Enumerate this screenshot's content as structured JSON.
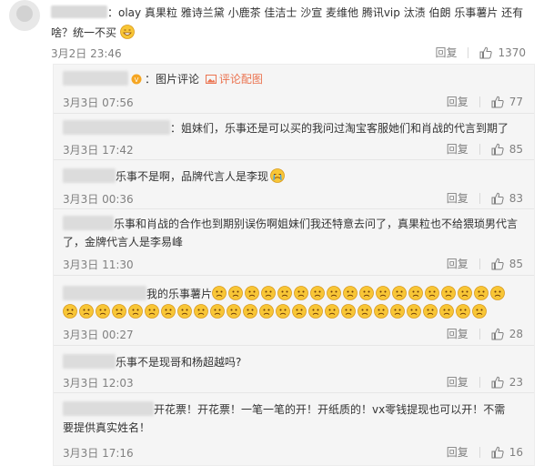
{
  "main_comment": {
    "text_line1": "：olay 真果粒 雅诗兰黛 小鹿茶 佳洁士 沙宣 麦维他 腾讯vip 汰渍 伯朗 乐事薯片 还有",
    "text_line2": "啥？统一不买",
    "date": "3月2日 23:46",
    "reply_label": "回复",
    "likes": "1370"
  },
  "replies": [
    {
      "text": "：图片评论",
      "link": "评论配图",
      "date": "3月3日 07:56",
      "reply_label": "回复",
      "likes": "77"
    },
    {
      "text": "：姐妹们，乐事还是可以买的我问过淘宝客服她们和肖战的代言到期了",
      "date": "3月3日 17:42",
      "reply_label": "回复",
      "likes": "85"
    },
    {
      "text": "乐事不是啊，品牌代言人是李现",
      "date": "3月3日 00:36",
      "reply_label": "回复",
      "likes": "83"
    },
    {
      "text_line1": "乐事和肖战的合作也到期别误伤啊姐妹们我还特意去问了，真果粒也不给猥琐男代言",
      "text_line2": "了，金牌代言人是李易峰",
      "date": "3月3日 11:30",
      "reply_label": "回复",
      "likes": "85"
    },
    {
      "text": "我的乐事薯片",
      "date": "3月3日 00:27",
      "reply_label": "回复",
      "likes": "28"
    },
    {
      "text": "乐事不是现哥和杨超越吗?",
      "date": "3月3日 12:03",
      "reply_label": "回复",
      "likes": "23"
    },
    {
      "text_line1": "开花票！开花票！一笔一笔的开！开纸质的！vx零钱提现也可以开！不需",
      "text_line2": "要提供真实姓名！",
      "date": "3月3日 17:16",
      "reply_label": "回复",
      "likes": "16"
    }
  ],
  "colors": {
    "link": "#eb7350",
    "meta": "#808080",
    "reply_bg": "#f5f5f5"
  }
}
